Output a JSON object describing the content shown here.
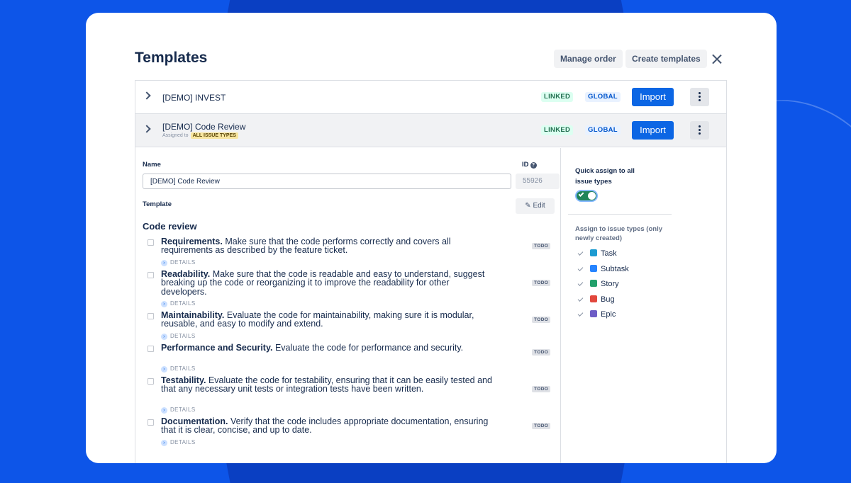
{
  "modal": {
    "title": "Templates",
    "manage_order": "Manage order",
    "create_templates": "Create templates"
  },
  "rows": [
    {
      "name": "[DEMO] INVEST",
      "linked": "LINKED",
      "global": "GLOBAL",
      "import": "Import"
    },
    {
      "name": "[DEMO] Code Review",
      "assigned_prefix": "Assigned to",
      "assigned_tag": "ALL ISSUE TYPES",
      "linked": "LINKED",
      "global": "GLOBAL",
      "import": "Import"
    }
  ],
  "detail": {
    "name_label": "Name",
    "name_value": "[DEMO] Code Review",
    "id_label": "ID",
    "id_value": "55926",
    "template_label": "Template",
    "edit_label": "Edit",
    "section_title": "Code review",
    "todo_label": "TODO",
    "details_label": "DETAILS",
    "items": [
      {
        "title": "Requirements.",
        "text": "Make sure that the code performs correctly and covers all requirements as described by the feature ticket."
      },
      {
        "title": "Readability.",
        "text": "Make sure that the code is readable and easy to understand, suggest breaking up the code or reorganizing it to improve the readability for other developers."
      },
      {
        "title": "Maintainability.",
        "text": "Evaluate the code for maintainability, making sure it is modular, reusable, and easy to modify and extend."
      },
      {
        "title": "Performance and Security.",
        "text": "Evaluate the code for performance and security."
      },
      {
        "title": "Testability.",
        "text": "Evaluate the code for testability, ensuring that it can be easily tested and that any necessary unit tests or integration tests have been written."
      },
      {
        "title": "Documentation.",
        "text": "Verify that the code includes appropriate documentation, ensuring that it is clear, concise, and up to date."
      }
    ]
  },
  "sidebar": {
    "quick_assign": "Quick assign to all issue types",
    "assign_label": "Assign to issue types (only newly created)",
    "issue_types": [
      {
        "label": "Task",
        "color": "#1d9bd1"
      },
      {
        "label": "Subtask",
        "color": "#2684ff"
      },
      {
        "label": "Story",
        "color": "#22a06b"
      },
      {
        "label": "Bug",
        "color": "#e2483d"
      },
      {
        "label": "Epic",
        "color": "#6e5dc6"
      }
    ]
  }
}
